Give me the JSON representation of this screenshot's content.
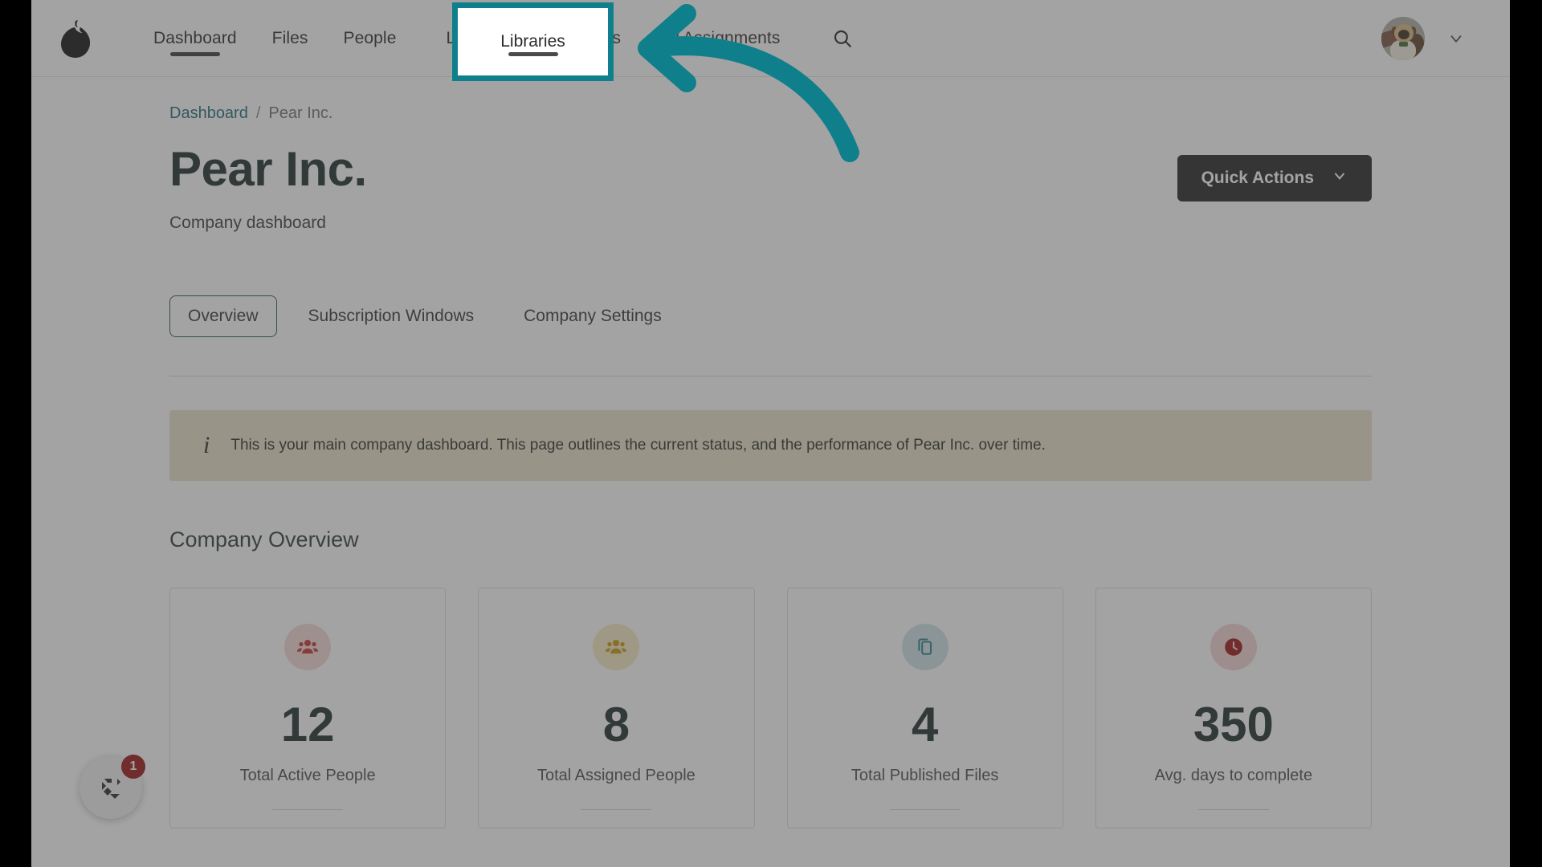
{
  "colors": {
    "accent_teal": "#0f7f8c",
    "breadcrumb_link": "#1b6b77",
    "quick_actions_bg": "#222222",
    "banner_bg": "#e9e0c6",
    "card_icon_red": "#c7302c",
    "card_icon_gold": "#c9960c",
    "card_icon_teal": "#2a7f8c",
    "card_icon_clock": "#9b1111",
    "badge_red": "#9b1111",
    "overlay_dim": "rgba(72,72,72,0.50)"
  },
  "topnav": {
    "logo_name": "pear-logo",
    "items": [
      {
        "label": "Dashboard",
        "active": true
      },
      {
        "label": "Files",
        "active": false
      },
      {
        "label": "People",
        "active": false
      },
      {
        "label": "Libraries",
        "active": false
      },
      {
        "label": "Reports",
        "active": false
      },
      {
        "label": "My Assignments",
        "active": false
      }
    ],
    "search_icon": "search-icon",
    "avatar_alt": "user-avatar",
    "account_chevron": "chevron-down-icon"
  },
  "highlight": {
    "target_label": "Libraries",
    "annotation": "curved-arrow-pointing-left"
  },
  "breadcrumb": {
    "link": "Dashboard",
    "separator": "/",
    "current": "Pear Inc."
  },
  "header": {
    "title": "Pear Inc.",
    "subtitle": "Company dashboard",
    "quick_actions_label": "Quick Actions",
    "quick_actions_chevron": "chevron-down-icon"
  },
  "tabs": [
    {
      "label": "Overview",
      "selected": true
    },
    {
      "label": "Subscription Windows",
      "selected": false
    },
    {
      "label": "Company Settings",
      "selected": false
    }
  ],
  "banner": {
    "icon": "info-icon",
    "text": "This is your main company dashboard. This page outlines the current status, and the performance of Pear Inc. over time."
  },
  "overview": {
    "section_title": "Company Overview",
    "cards": [
      {
        "icon": "group-people-icon",
        "value": "12",
        "label": "Total Active People"
      },
      {
        "icon": "group-people-icon",
        "value": "8",
        "label": "Total Assigned People"
      },
      {
        "icon": "copy-files-icon",
        "value": "4",
        "label": "Total Published Files"
      },
      {
        "icon": "clock-icon",
        "value": "350",
        "label": "Avg. days to complete"
      }
    ]
  },
  "chat_widget": {
    "icon": "chat-launcher-icon",
    "badge": "1"
  }
}
